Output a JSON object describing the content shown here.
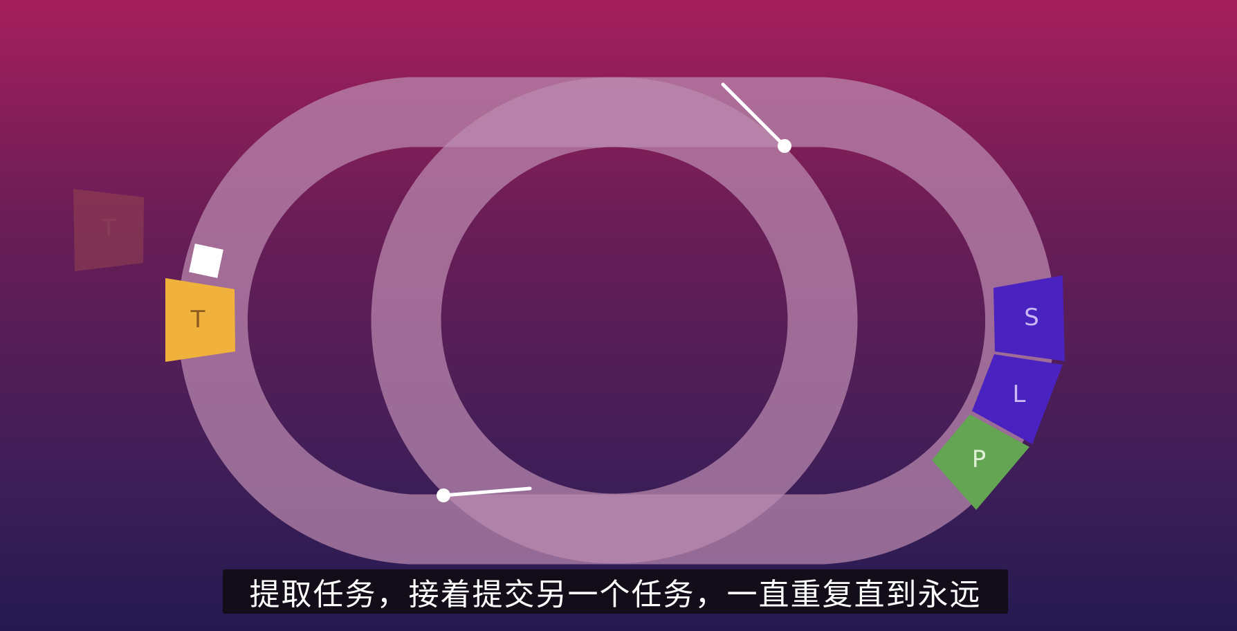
{
  "subtitle": "提取任务，接着提交另一个任务，一直重复直到永远",
  "segments": {
    "t": "T",
    "s": "S",
    "l": "L",
    "p": "P",
    "faded": "T"
  },
  "colors": {
    "track": "#b07ba3",
    "t_segment": "#f0b23c",
    "s_segment": "#4a22c0",
    "l_segment": "#4a22c0",
    "p_segment": "#63a552",
    "subtitle_bg": "#120d18"
  }
}
